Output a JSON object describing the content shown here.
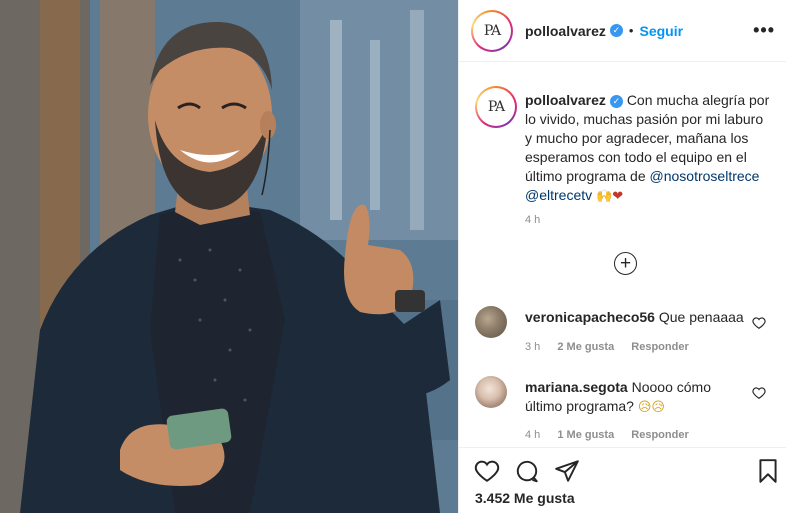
{
  "post": {
    "username": "polloalvarez",
    "avatar_logo": "PA",
    "separator": "•",
    "follow_label": "Seguir",
    "more_icon": "•••"
  },
  "caption": {
    "username": "polloalvarez",
    "text": "Con mucha alegría por lo vivido, muchas pasión por mi laburo y mucho por agradecer, mañana los esperamos con todo el equipo en el último programa de",
    "mention1": "@nosotroseltrece",
    "mention2": "@eltrecetv",
    "emojis": "🙌❤",
    "time": "4 h"
  },
  "load_more_icon": "+",
  "comments": [
    {
      "username": "veronicapacheco56",
      "text": "Que penaaaa",
      "time": "3 h",
      "likes": "2 Me gusta",
      "reply": "Responder"
    },
    {
      "username": "mariana.segota",
      "text": "Noooo cómo último programa?",
      "emojis": "😥😥",
      "time": "4 h",
      "likes": "1 Me gusta",
      "reply": "Responder"
    }
  ],
  "likes_count": "3.452 Me gusta",
  "colors": {
    "accent": "#0095f6",
    "verified": "#3897f0",
    "muted": "#8e8e8e",
    "text": "#262626"
  }
}
